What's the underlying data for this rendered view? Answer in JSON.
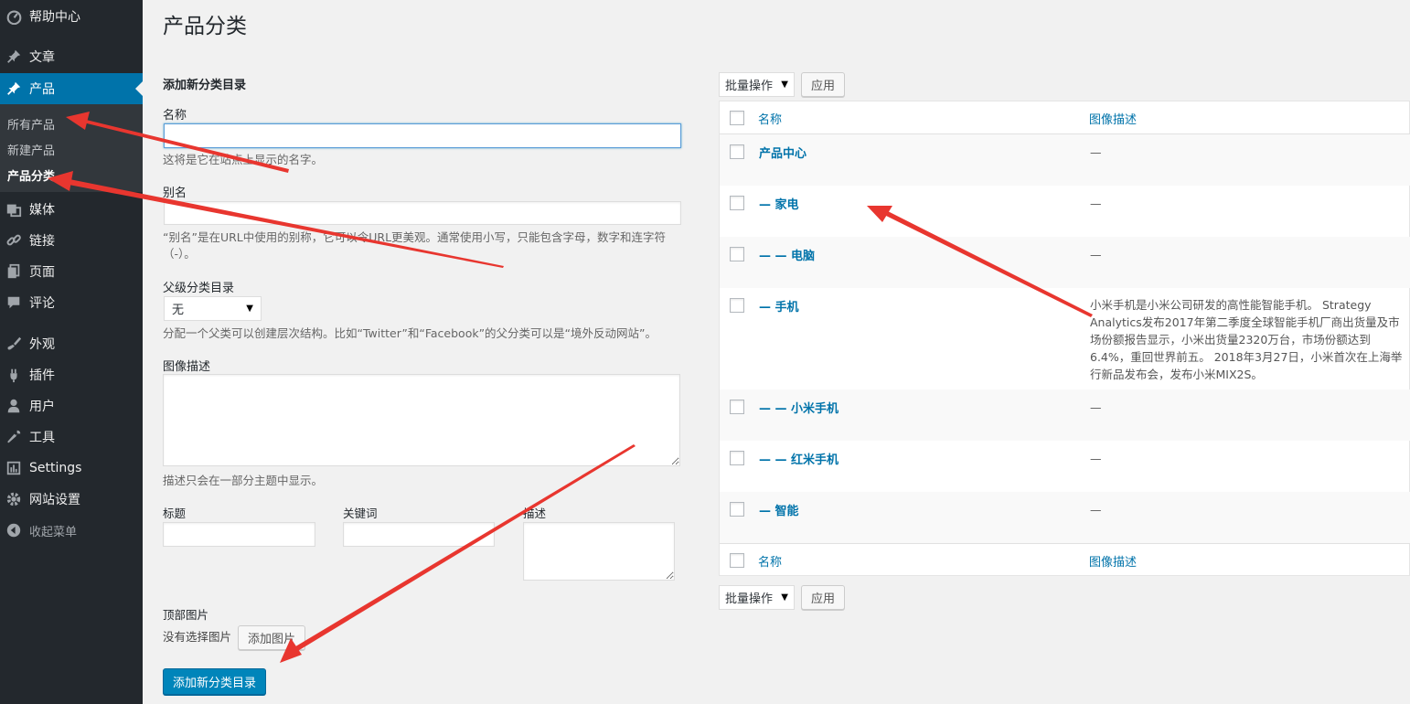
{
  "sidebar": {
    "items": [
      {
        "label": "帮助中心",
        "icon": "dashboard-icon"
      },
      {
        "label": "文章",
        "icon": "pin-icon"
      },
      {
        "label": "产品",
        "icon": "pin-icon",
        "active": true
      },
      {
        "label": "媒体",
        "icon": "media-icon"
      },
      {
        "label": "链接",
        "icon": "link-icon"
      },
      {
        "label": "页面",
        "icon": "page-icon"
      },
      {
        "label": "评论",
        "icon": "comment-icon"
      },
      {
        "label": "外观",
        "icon": "brush-icon"
      },
      {
        "label": "插件",
        "icon": "plugin-icon"
      },
      {
        "label": "用户",
        "icon": "user-icon"
      },
      {
        "label": "工具",
        "icon": "wrench-icon"
      },
      {
        "label": "Settings",
        "icon": "settings-icon"
      },
      {
        "label": "网站设置",
        "icon": "gear-icon"
      }
    ],
    "submenu": [
      "所有产品",
      "新建产品",
      "产品分类"
    ],
    "collapse_label": "收起菜单"
  },
  "page": {
    "title": "产品分类"
  },
  "form": {
    "heading": "添加新分类目录",
    "name_label": "名称",
    "name_value": "",
    "name_help": "这将是它在站点上显示的名字。",
    "slug_label": "别名",
    "slug_value": "",
    "slug_help": "“别名”是在URL中使用的别称，它可以令URL更美观。通常使用小写，只能包含字母，数字和连字符（-）。",
    "parent_label": "父级分类目录",
    "parent_value": "无",
    "parent_help": "分配一个父类可以创建层次结构。比如“Twitter”和“Facebook”的父分类可以是“境外反动网站”。",
    "image_desc_label": "图像描述",
    "image_desc_help": "描述只会在一部分主题中显示。",
    "seo_title_label": "标题",
    "seo_keywords_label": "关键词",
    "seo_desc_label": "描述",
    "top_image_label": "顶部图片",
    "no_image_text": "没有选择图片",
    "add_image_button": "添加图片",
    "submit_button": "添加新分类目录"
  },
  "table": {
    "bulk_action": "批量操作",
    "apply_button": "应用",
    "col_name": "名称",
    "col_desc": "图像描述",
    "rows": [
      {
        "name": "产品中心",
        "desc": "—"
      },
      {
        "name": "— 家电",
        "desc": "—"
      },
      {
        "name": "— — 电脑",
        "desc": "—"
      },
      {
        "name": "— 手机",
        "desc": "小米手机是小米公司研发的高性能智能手机。 Strategy Analytics发布2017年第二季度全球智能手机厂商出货量及市场份额报告显示，小米出货量2320万台，市场份额达到6.4%，重回世界前五。 2018年3月27日，小米首次在上海举行新品发布会，发布小米MIX2S。"
      },
      {
        "name": "— — 小米手机",
        "desc": "—"
      },
      {
        "name": "— — 红米手机",
        "desc": "—"
      },
      {
        "name": "— 智能",
        "desc": "—"
      }
    ]
  },
  "colors": {
    "sidebar_bg": "#23282d",
    "active_bg": "#0073aa",
    "link": "#0073aa",
    "primary_button": "#0085ba",
    "annotation_arrow": "#e8362f"
  }
}
